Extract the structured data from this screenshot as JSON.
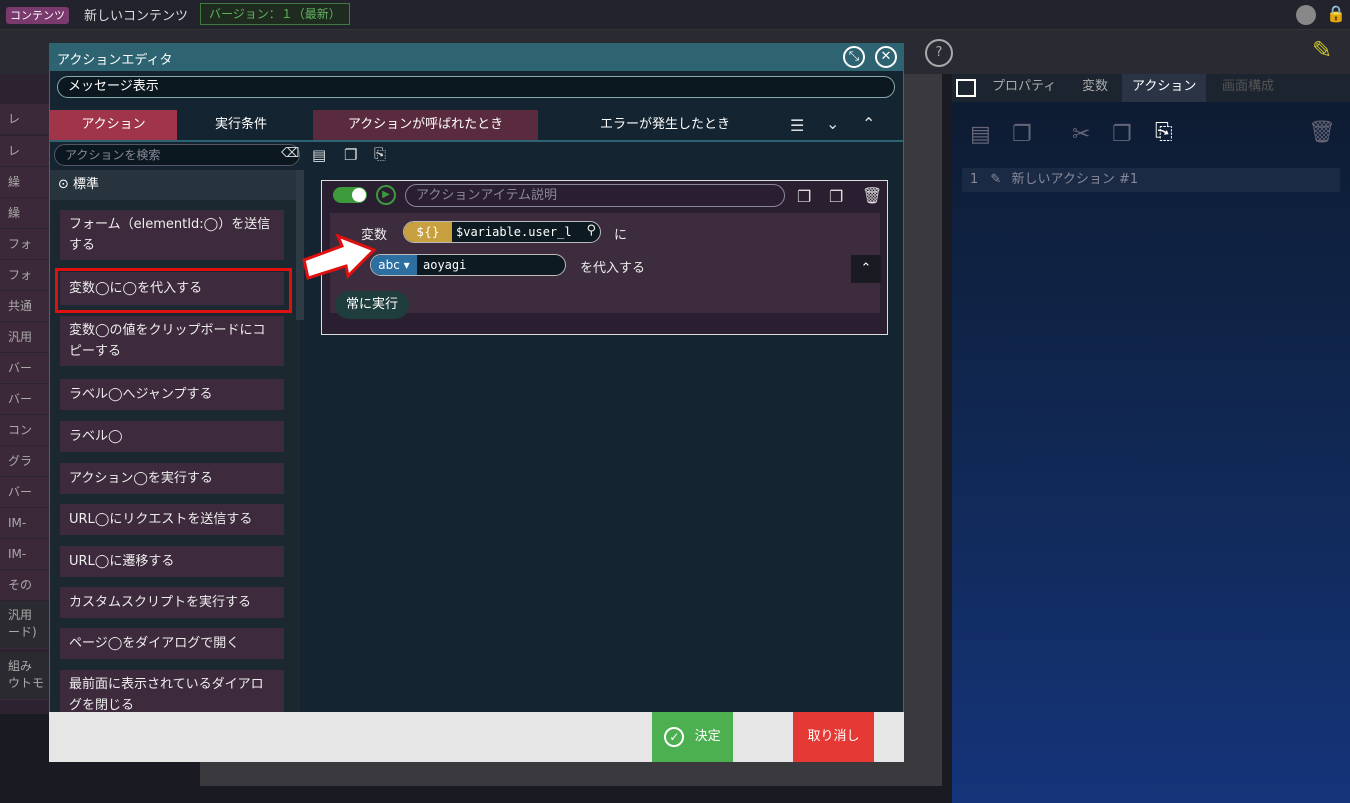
{
  "header": {
    "badge": "コンテンツ",
    "content_title": "新しいコンテンツ",
    "version": "バージョン：１（最新）"
  },
  "palette": {
    "items": [
      "レ",
      "レ",
      "繰",
      "繰",
      "フォ",
      "フォ",
      "共通",
      "汎用",
      "バー",
      "バー",
      "コン",
      "グラ",
      "バー",
      "IM-",
      "IM-",
      "その",
      "汎用\nード)",
      "組み\nウトモ"
    ]
  },
  "right_panel": {
    "tabs": [
      "プロパティ",
      "変数",
      "アクション",
      "画面構成"
    ],
    "action_item": {
      "index": "1",
      "label": "新しいアクション #1"
    }
  },
  "modal": {
    "title": "アクションエディタ",
    "message_field": "メッセージ表示",
    "tabs": [
      {
        "label": "アクション",
        "color": "#a0354a"
      },
      {
        "label": "実行条件",
        "color": "#142430"
      },
      {
        "label": "アクションが呼ばれたとき",
        "color": "#5a2a3e"
      },
      {
        "label": "エラーが発生したとき",
        "color": "#142430"
      }
    ],
    "search_placeholder": "アクションを検索",
    "category": "標準",
    "list_items": [
      "フォーム（elementId:◯）を送信する",
      "変数◯に◯を代入する",
      "変数◯の値をクリップボードにコピーする",
      "ラベル◯へジャンプする",
      "ラベル◯",
      "アクション◯を実行する",
      "URL◯にリクエストを送信する",
      "URL◯に遷移する",
      "カスタムスクリプトを実行する",
      "ページ◯をダイアログで開く",
      "最前面に表示されているダイアログを閉じる"
    ],
    "editor": {
      "description_placeholder": "アクションアイテム説明",
      "var_label": "変数",
      "var_tag": "${}",
      "var_value": "$variable.user_l",
      "ni": "に",
      "val_tag": "abc ▾",
      "val_value": "aoyagi",
      "assign_suffix": "を代入する",
      "condition": "常に実行"
    },
    "ok_label": "決定",
    "cancel_label": "取り消し"
  },
  "colors": {
    "highlight": "#e01010",
    "ok": "#4caf50",
    "cancel": "#e53935",
    "header": "#2e6472"
  }
}
